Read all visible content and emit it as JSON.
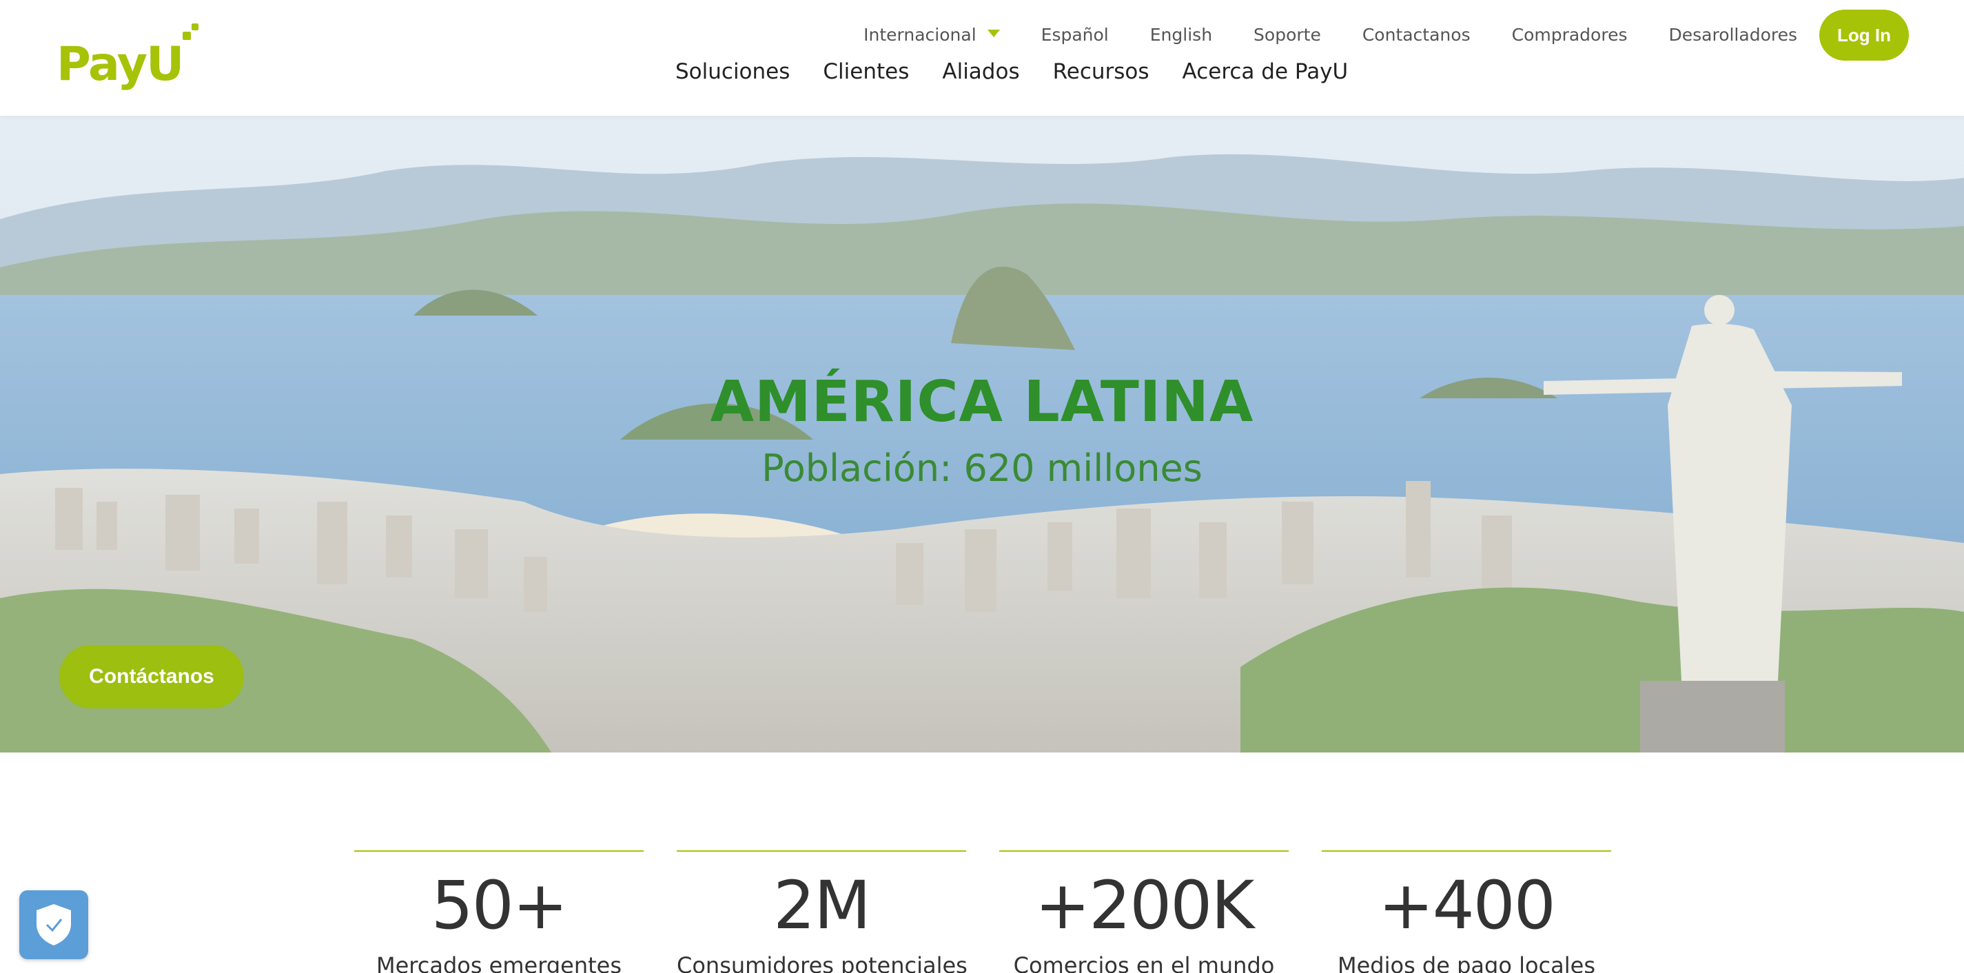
{
  "brand": {
    "logo_text": "PayU",
    "accent": "#a6c307"
  },
  "top_nav": {
    "region": "Internacional",
    "links": [
      "Español",
      "English",
      "Soporte",
      "Contactanos",
      "Compradores",
      "Desarolladores"
    ],
    "login": "Log In"
  },
  "main_nav": [
    "Soluciones",
    "Clientes",
    "Aliados",
    "Recursos",
    "Acerca de PayU"
  ],
  "hero": {
    "title": "AMÉRICA LATINA",
    "subtitle": "Población: 620 millones",
    "cta": "Contáctanos"
  },
  "stats": [
    {
      "value": "50+",
      "label": "Mercados emergentes"
    },
    {
      "value": "2M",
      "label": "Consumidores potenciales"
    },
    {
      "value": "+200K",
      "label": "Comercios en el mundo"
    },
    {
      "value": "+400",
      "label": "Medios de pago locales"
    }
  ],
  "badge": {
    "icon": "shield-check-icon"
  }
}
